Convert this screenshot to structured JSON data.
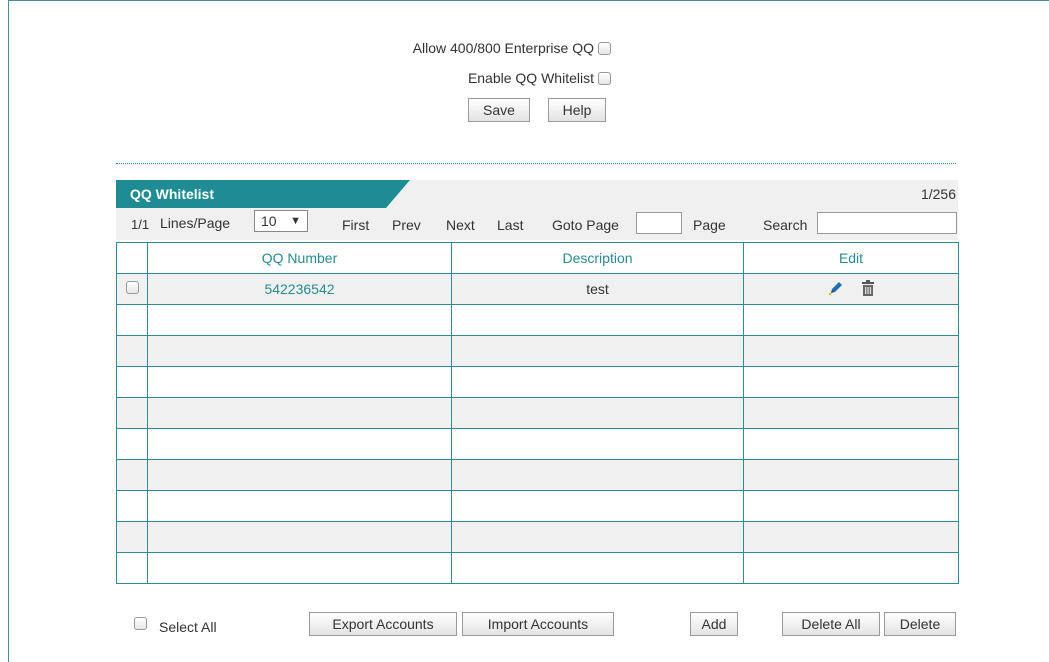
{
  "options": {
    "allow_enterprise_label": "Allow 400/800 Enterprise QQ",
    "enable_whitelist_label": "Enable QQ Whitelist"
  },
  "top_buttons": {
    "save": "Save",
    "help": "Help"
  },
  "panel": {
    "tab_title": "QQ Whitelist",
    "count": "1/256"
  },
  "pager": {
    "page_indicator": "1/1",
    "lines_per_page_label": "Lines/Page",
    "lines_per_page_value": "10",
    "first": "First",
    "prev": "Prev",
    "next": "Next",
    "last": "Last",
    "goto_label": "Goto Page",
    "page_label": "Page",
    "search_label": "Search"
  },
  "table": {
    "headers": [
      "QQ Number",
      "Description",
      "Edit"
    ],
    "rows": [
      {
        "qq_number": "542236542",
        "description": "test"
      }
    ],
    "empty_rows": 9
  },
  "footer": {
    "select_all": "Select All",
    "export": "Export Accounts",
    "import": "Import Accounts",
    "add": "Add",
    "delete_all": "Delete All",
    "delete": "Delete"
  },
  "colors": {
    "accent": "#1e8c92",
    "border": "#2d8c93",
    "stripe": "#f0f0f0"
  }
}
